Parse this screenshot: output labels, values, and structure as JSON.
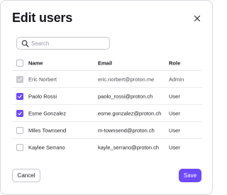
{
  "dialog": {
    "title": "Edit users",
    "close_icon": "close-icon"
  },
  "search": {
    "placeholder": "Search",
    "value": "",
    "icon": "search-icon"
  },
  "table": {
    "columns": [
      "Name",
      "Email",
      "Role"
    ],
    "rows": [
      {
        "name": "Eric Norbert",
        "email": "eric.norbert@proton.me",
        "role": "Admin",
        "checked": true,
        "disabled": true
      },
      {
        "name": "Paolo Rossi",
        "email": "paolo_rossi@proton.ch",
        "role": "User",
        "checked": true,
        "disabled": false
      },
      {
        "name": "Esme Gonzalez",
        "email": "esme.gonzalez@proton.ch",
        "role": "User",
        "checked": true,
        "disabled": false
      },
      {
        "name": "Miles Townsend",
        "email": "m-townsend@proton.ch",
        "role": "User",
        "checked": false,
        "disabled": false
      },
      {
        "name": "Kaylee Serrano",
        "email": "kayle_serrano@proton.ch",
        "role": "User",
        "checked": false,
        "disabled": false
      }
    ]
  },
  "footer": {
    "cancel_label": "Cancel",
    "save_label": "Save"
  },
  "colors": {
    "accent": "#6d4aff",
    "disabled_checkbox": "#c9c9ce"
  }
}
